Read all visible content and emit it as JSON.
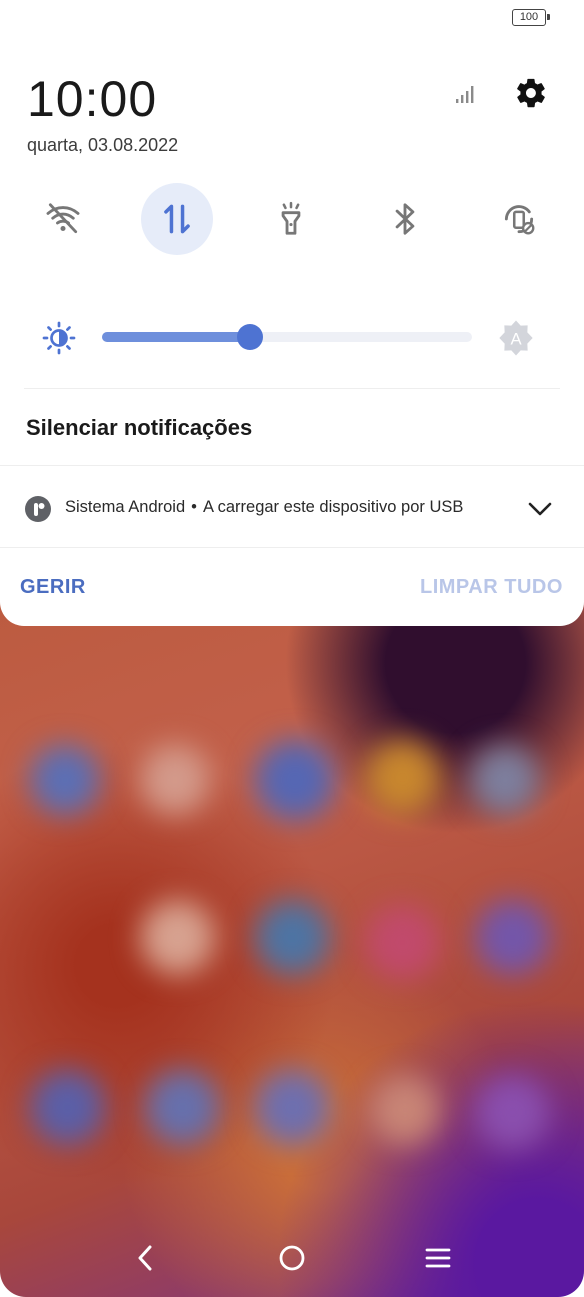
{
  "status_bar": {
    "battery_label": "100"
  },
  "header": {
    "time": "10:00",
    "date": "quarta, 03.08.2022",
    "signal_icon": "signal-icon",
    "settings_icon": "gear-icon"
  },
  "quick_tiles": [
    {
      "name": "wifi",
      "icon": "wifi-off-icon",
      "active": false
    },
    {
      "name": "mobile-data",
      "icon": "data-transfer-icon",
      "active": true
    },
    {
      "name": "flashlight",
      "icon": "flashlight-icon",
      "active": false
    },
    {
      "name": "bluetooth",
      "icon": "bluetooth-icon",
      "active": false
    },
    {
      "name": "auto-rotate",
      "icon": "rotation-lock-icon",
      "active": false
    }
  ],
  "brightness": {
    "level": 0.4,
    "auto_icon": "auto-brightness-icon",
    "auto_label": "A"
  },
  "notifications": {
    "section_title": "Silenciar notificações",
    "items": [
      {
        "app": "Sistema Android",
        "separator": "•",
        "message": "A carregar este dispositivo por USB"
      }
    ]
  },
  "actions": {
    "manage_label": "GERIR",
    "clear_all_label": "LIMPAR TUDO"
  },
  "colors": {
    "accent": "#4e73d2",
    "accent_light": "#e6ecf9",
    "disabled_text": "#b9c6e8"
  },
  "navigation": {
    "back_icon": "back-icon",
    "home_icon": "home-icon",
    "recents_icon": "menu-icon"
  }
}
